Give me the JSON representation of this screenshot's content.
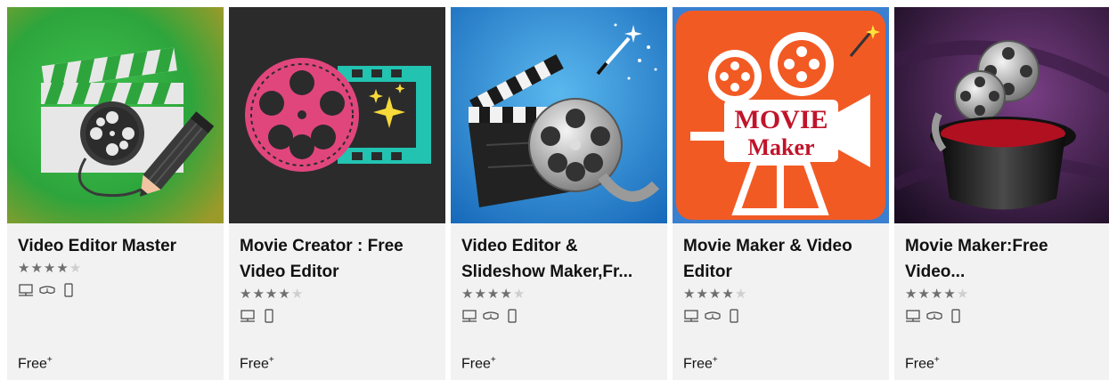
{
  "colors": {
    "card_bg": "#f2f2f2",
    "star_on": "#6f6f6f",
    "star_off": "#cfcfcf"
  },
  "apps": [
    {
      "title": "Video Editor Master",
      "rating_stars": 4,
      "platforms": [
        "pc-icon",
        "hololens-icon",
        "mobile-icon"
      ],
      "price": "Free",
      "price_suffix": "+"
    },
    {
      "title": "Movie Creator : Free Video Editor",
      "rating_stars": 4,
      "platforms": [
        "pc-icon",
        "mobile-icon"
      ],
      "price": "Free",
      "price_suffix": "+"
    },
    {
      "title": "Video Editor & Slideshow Maker,Fr...",
      "rating_stars": 4,
      "platforms": [
        "pc-icon",
        "hololens-icon",
        "mobile-icon"
      ],
      "price": "Free",
      "price_suffix": "+"
    },
    {
      "title": "Movie Maker & Video Editor",
      "rating_stars": 4,
      "platforms": [
        "pc-icon",
        "hololens-icon",
        "mobile-icon"
      ],
      "price": "Free",
      "price_suffix": "+"
    },
    {
      "title": "Movie Maker:Free Video...",
      "rating_stars": 4,
      "platforms": [
        "pc-icon",
        "hololens-icon",
        "mobile-icon"
      ],
      "price": "Free",
      "price_suffix": "+"
    }
  ],
  "thumb_logos": {
    "movie_maker_line1": "MOVIE",
    "movie_maker_line2": "Maker"
  }
}
